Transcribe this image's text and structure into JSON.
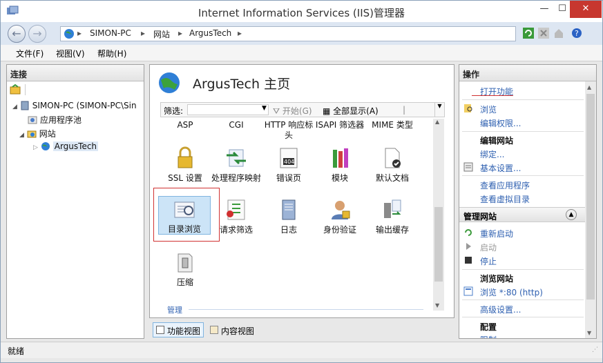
{
  "window": {
    "title": "Internet Information Services (IIS)管理器"
  },
  "address": {
    "crumbs": [
      "SIMON-PC",
      "网站",
      "ArgusTech"
    ],
    "separator": "▸"
  },
  "menu": {
    "file": "文件(F)",
    "view": "视图(V)",
    "help": "帮助(H)"
  },
  "connections": {
    "header": "连接",
    "tree": {
      "root": "SIMON-PC (SIMON-PC\\Sin",
      "app_pools": "应用程序池",
      "sites": "网站",
      "site": "ArgusTech"
    }
  },
  "center": {
    "title": "ArgusTech 主页",
    "filter_label": "筛选:",
    "start_label": "开始(G)",
    "show_all_label": "全部显示(A)",
    "row0": [
      "ASP",
      "CGI",
      "HTTP 响应标头",
      "ISAPI 筛选器",
      "MIME 类型"
    ],
    "row1": [
      "SSL 设置",
      "处理程序映射",
      "错误页",
      "模块",
      "默认文档"
    ],
    "row2": [
      "目录浏览",
      "请求筛选",
      "日志",
      "身份验证",
      "输出缓存"
    ],
    "row3": [
      "压缩"
    ],
    "group_label": "管理",
    "error_page_badge": "404"
  },
  "tabs": {
    "features": "功能视图",
    "content": "内容视图"
  },
  "actions": {
    "header": "操作",
    "open_feature": "打开功能",
    "browse": "浏览",
    "edit_permissions": "编辑权限...",
    "edit_site": "编辑网站",
    "bindings": "绑定...",
    "basic_settings": "基本设置...",
    "view_apps": "查看应用程序",
    "view_vdirs": "查看虚拟目录",
    "manage_site": "管理网站",
    "restart": "重新启动",
    "start": "启动",
    "stop": "停止",
    "browse_site": "浏览网站",
    "browse_80": "浏览 *:80 (http)",
    "advanced": "高级设置...",
    "configure": "配置",
    "limits": "限制..."
  },
  "status": {
    "text": "就绪"
  },
  "colors": {
    "accent_link": "#2d5fb0",
    "highlight_box": "#d03030",
    "selected_tile": "#cce4f7"
  }
}
